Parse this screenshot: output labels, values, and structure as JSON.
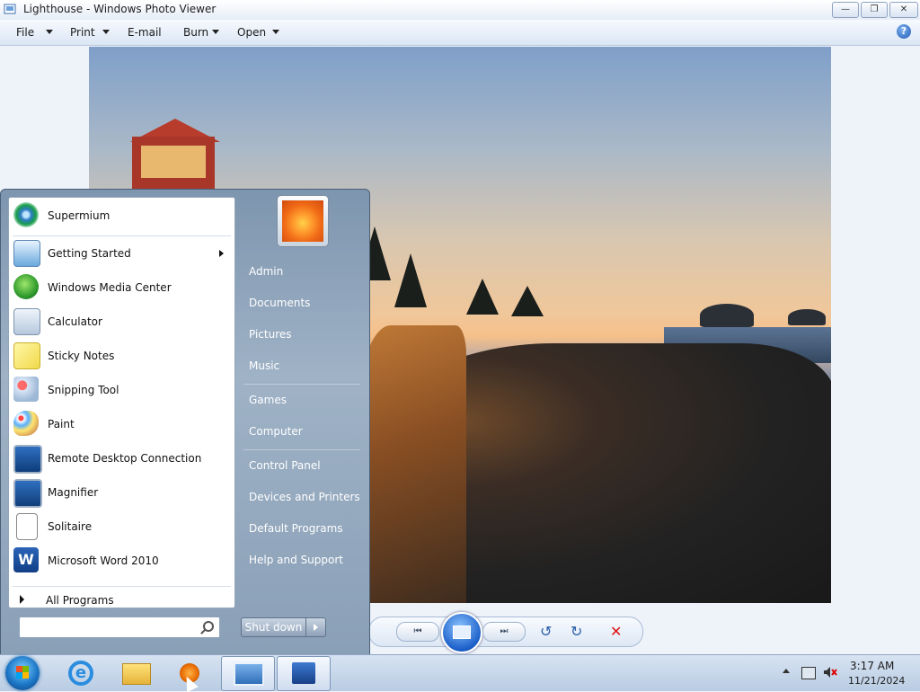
{
  "window": {
    "title": "Lighthouse - Windows Photo Viewer",
    "minimize": "—",
    "restore": "❐",
    "close": "✕"
  },
  "menu": {
    "file": "File",
    "print": "Print",
    "email": "E-mail",
    "burn": "Burn",
    "open": "Open",
    "help": "?"
  },
  "viewer_controls": {
    "previous": "⏮",
    "next": "⏭",
    "rotate_ccw": "↺",
    "rotate_cw": "↻",
    "delete": "✕",
    "zoom": "⇲"
  },
  "start_menu": {
    "programs": [
      {
        "label": "Supermium",
        "icon": "supermium-icon"
      },
      {
        "label": "Getting Started",
        "icon": "getting-started-icon",
        "submenu": true
      },
      {
        "label": "Windows Media Center",
        "icon": "media-center-icon"
      },
      {
        "label": "Calculator",
        "icon": "calculator-icon"
      },
      {
        "label": "Sticky Notes",
        "icon": "sticky-notes-icon"
      },
      {
        "label": "Snipping Tool",
        "icon": "snipping-tool-icon"
      },
      {
        "label": "Paint",
        "icon": "paint-icon"
      },
      {
        "label": "Remote Desktop Connection",
        "icon": "remote-desktop-icon"
      },
      {
        "label": "Magnifier",
        "icon": "magnifier-icon"
      },
      {
        "label": "Solitaire",
        "icon": "solitaire-icon"
      },
      {
        "label": "Microsoft Word 2010",
        "icon": "word-icon"
      }
    ],
    "all_programs": "All Programs",
    "search_placeholder": "",
    "right_links": [
      "Admin",
      "Documents",
      "Pictures",
      "Music",
      "Games",
      "Computer",
      "Control Panel",
      "Devices and Printers",
      "Default Programs",
      "Help and Support"
    ],
    "shutdown": "Shut down"
  },
  "taskbar": {
    "time": "3:17 AM",
    "date": "11/21/2024"
  }
}
